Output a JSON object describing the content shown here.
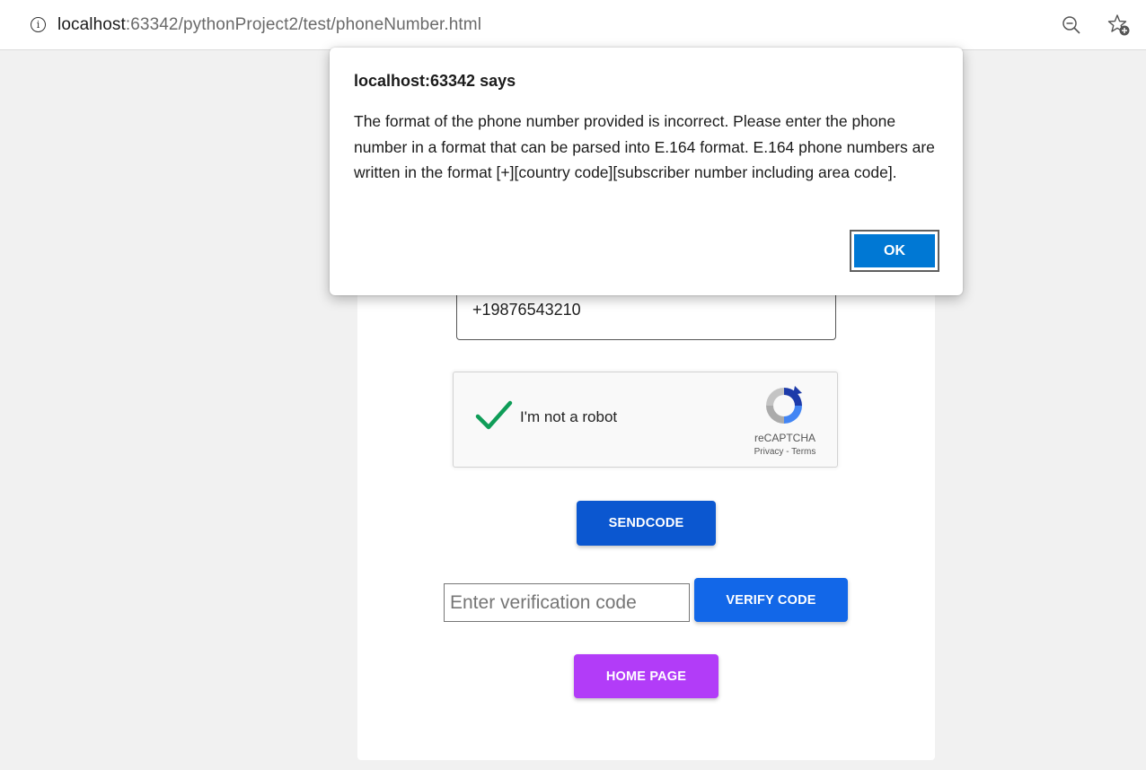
{
  "browser": {
    "url_host": "localhost",
    "url_rest": ":63342/pythonProject2/test/phoneNumber.html"
  },
  "form": {
    "phone_value": "+19876543210",
    "recaptcha": {
      "label": "I'm not a robot",
      "brand": "reCAPTCHA",
      "links": "Privacy - Terms"
    },
    "send_code_label": "SENDCODE",
    "verification_placeholder": "Enter verification code",
    "verify_code_label": "VERIFY CODE",
    "home_page_label": "HOME PAGE"
  },
  "dialog": {
    "title": "localhost:63342 says",
    "message": "The format of the phone number provided is incorrect. Please enter the phone number in a format that can be parsed into E.164 format. E.164 phone numbers are written in the format [+][country code][subscriber number including area code].",
    "ok_label": "OK"
  },
  "colors": {
    "send_button": "#0b57d0",
    "verify_button": "#1267e8",
    "home_button": "#b23cf8",
    "ok_button": "#0078d4",
    "check": "#0f9d58"
  },
  "icons": [
    "info-icon",
    "zoom-out-icon",
    "add-favorite-icon",
    "checkmark-icon",
    "recaptcha-logo-icon"
  ]
}
